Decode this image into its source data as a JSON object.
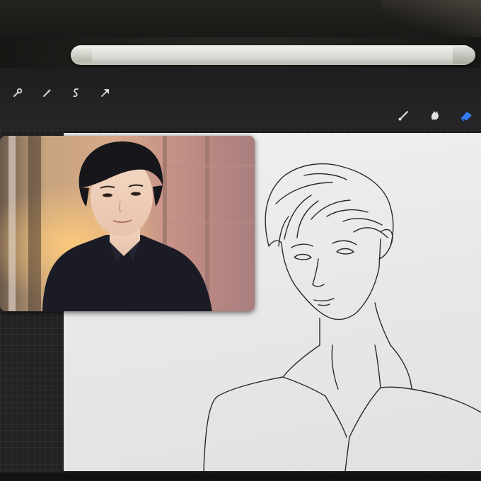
{
  "app": {
    "name": "",
    "accent_color": "#2f7cf6"
  },
  "toolbar": {
    "left_tools": [
      {
        "icon": "wrench-icon",
        "name": "actions"
      },
      {
        "icon": "magic-wand-icon",
        "name": "adjustments"
      },
      {
        "icon": "selection-icon",
        "name": "selection"
      },
      {
        "icon": "arrow-cursor-icon",
        "name": "transform"
      }
    ],
    "right_tools": [
      {
        "icon": "brush-icon",
        "name": "paint"
      },
      {
        "icon": "smudge-icon",
        "name": "smudge"
      },
      {
        "icon": "eraser-icon",
        "name": "erase",
        "active": true
      }
    ]
  },
  "reference": {
    "description_visible": false
  },
  "canvas": {
    "content": "line-art-portrait"
  }
}
